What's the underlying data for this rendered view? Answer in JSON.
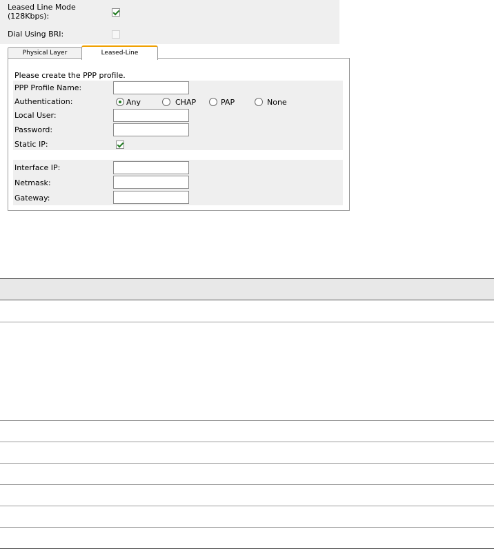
{
  "top": {
    "leased_line_mode_label_1": "Leased Line Mode",
    "leased_line_mode_label_2": "(128Kbps):",
    "leased_line_mode_checked": true,
    "dial_bri_label": "Dial Using BRI:",
    "dial_bri_checked": false
  },
  "tabs": [
    {
      "label": "Physical Layer",
      "active": false
    },
    {
      "label": "Leased-Line",
      "active": true
    }
  ],
  "form": {
    "intro": "Please create the PPP profile.",
    "ppp_profile_name_label": "PPP Profile Name:",
    "ppp_profile_name_value": "",
    "authentication_label": "Authentication:",
    "auth_options": [
      "Any",
      "CHAP",
      "PAP",
      "None"
    ],
    "auth_selected": "Any",
    "local_user_label": "Local User:",
    "local_user_value": "",
    "password_label": "Password:",
    "password_value": "",
    "static_ip_label": "Static IP:",
    "static_ip_checked": true,
    "interface_ip_label": "Interface IP:",
    "interface_ip_value": "",
    "netmask_label": "Netmask:",
    "netmask_value": "",
    "gateway_label": "Gateway:",
    "gateway_value": ""
  },
  "colors": {
    "panel_gray": "#efefef",
    "active_tab_accent": "#f0a000",
    "check_green": "#1f7a1f"
  }
}
